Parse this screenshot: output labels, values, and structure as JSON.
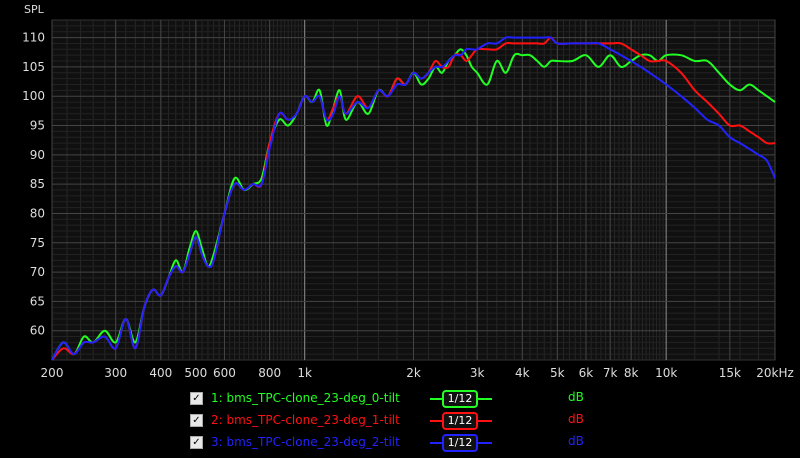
{
  "chart_data": {
    "type": "line",
    "ylabel": "SPL",
    "x_scale": "log",
    "xlim": [
      200,
      20000
    ],
    "ylim": [
      55,
      113
    ],
    "grid": true,
    "x_ticks": [
      200,
      300,
      400,
      500,
      600,
      800,
      1000,
      2000,
      3000,
      4000,
      5000,
      6000,
      7000,
      8000,
      10000,
      15000,
      20000
    ],
    "x_tick_labels": [
      "200",
      "300",
      "400",
      "500",
      "600",
      "800",
      "1k",
      "2k",
      "3k",
      "4k",
      "5k",
      "6k",
      "7k",
      "8k",
      "10k",
      "15k",
      "20kHz"
    ],
    "y_ticks": [
      60,
      65,
      70,
      75,
      80,
      85,
      90,
      95,
      100,
      105,
      110
    ],
    "y_tick_labels": [
      "60",
      "65",
      "70",
      "75",
      "80",
      "85",
      "90",
      "95",
      "100",
      "105",
      "110"
    ],
    "series": [
      {
        "name": "1: bms_TPC-clone_23-deg_0-tilt",
        "color": "#22ff22",
        "smoothing": "1/12",
        "unit": "dB",
        "x": [
          200,
          215,
          230,
          245,
          260,
          280,
          300,
          320,
          340,
          360,
          380,
          400,
          420,
          440,
          460,
          480,
          500,
          520,
          540,
          560,
          600,
          640,
          680,
          720,
          760,
          800,
          850,
          900,
          950,
          1000,
          1050,
          1100,
          1150,
          1200,
          1250,
          1300,
          1400,
          1500,
          1600,
          1700,
          1800,
          1900,
          2000,
          2100,
          2200,
          2300,
          2400,
          2500,
          2600,
          2700,
          2800,
          2900,
          3000,
          3200,
          3400,
          3600,
          3800,
          4000,
          4200,
          4400,
          4600,
          4800,
          5000,
          5500,
          6000,
          6500,
          7000,
          7500,
          8000,
          8500,
          9000,
          9500,
          10000,
          11000,
          12000,
          13000,
          14000,
          15000,
          16000,
          17000,
          18000,
          19000,
          20000
        ],
        "y": [
          55,
          58,
          56,
          59,
          58,
          60,
          58,
          62,
          58,
          64,
          67,
          66,
          69,
          72,
          70,
          74,
          77,
          74,
          71,
          73,
          80,
          86,
          84,
          85,
          86,
          92,
          96,
          95,
          97,
          100,
          99,
          101,
          95,
          98,
          101,
          96,
          99,
          97,
          101,
          100,
          103,
          102,
          104,
          102,
          103,
          105,
          104,
          106,
          107,
          108,
          107,
          105,
          104,
          102,
          106,
          104,
          107,
          107,
          107,
          106,
          105,
          106,
          106,
          106,
          107,
          105,
          107,
          105,
          106,
          107,
          107,
          106,
          107,
          107,
          106,
          106,
          104,
          102,
          101,
          102,
          101,
          100,
          99
        ]
      },
      {
        "name": "2: bms_TPC-clone_23-deg_1-tilt",
        "color": "#ff1111",
        "smoothing": "1/12",
        "unit": "dB",
        "x": [
          200,
          215,
          230,
          245,
          260,
          280,
          300,
          320,
          340,
          360,
          380,
          400,
          420,
          440,
          460,
          480,
          500,
          520,
          540,
          560,
          600,
          640,
          680,
          720,
          760,
          800,
          850,
          900,
          950,
          1000,
          1050,
          1100,
          1150,
          1200,
          1250,
          1300,
          1400,
          1500,
          1600,
          1700,
          1800,
          1900,
          2000,
          2100,
          2200,
          2300,
          2400,
          2500,
          2600,
          2700,
          2800,
          2900,
          3000,
          3200,
          3400,
          3600,
          3800,
          4000,
          4200,
          4400,
          4600,
          4800,
          5000,
          5500,
          6000,
          6500,
          7000,
          7500,
          8000,
          8500,
          9000,
          9500,
          10000,
          11000,
          12000,
          13000,
          14000,
          15000,
          16000,
          17000,
          18000,
          19000,
          20000
        ],
        "y": [
          55,
          57,
          56,
          58,
          58,
          59,
          57,
          62,
          57,
          64,
          67,
          66,
          69,
          71,
          70,
          73,
          76,
          73,
          71,
          72,
          80,
          85,
          84,
          85,
          85,
          92,
          97,
          96,
          97,
          100,
          99,
          100,
          96,
          98,
          100,
          97,
          100,
          98,
          101,
          100,
          103,
          102,
          104,
          103,
          104,
          106,
          105,
          105,
          107,
          107,
          106,
          107,
          108,
          108,
          108,
          109,
          109,
          109,
          109,
          109,
          109,
          110,
          109,
          109,
          109,
          109,
          109,
          109,
          108,
          107,
          106,
          106,
          106,
          104,
          101,
          99,
          97,
          95,
          95,
          94,
          93,
          92,
          92
        ]
      },
      {
        "name": "3: bms_TPC-clone_23-deg_2-tilt",
        "color": "#2222ff",
        "smoothing": "1/12",
        "unit": "dB",
        "x": [
          200,
          215,
          230,
          245,
          260,
          280,
          300,
          320,
          340,
          360,
          380,
          400,
          420,
          440,
          460,
          480,
          500,
          520,
          540,
          560,
          600,
          640,
          680,
          720,
          760,
          800,
          850,
          900,
          950,
          1000,
          1050,
          1100,
          1150,
          1200,
          1250,
          1300,
          1400,
          1500,
          1600,
          1700,
          1800,
          1900,
          2000,
          2100,
          2200,
          2300,
          2400,
          2500,
          2600,
          2700,
          2800,
          2900,
          3000,
          3200,
          3400,
          3600,
          3800,
          4000,
          4200,
          4400,
          4600,
          4800,
          5000,
          5500,
          6000,
          6500,
          7000,
          7500,
          8000,
          8500,
          9000,
          9500,
          10000,
          11000,
          12000,
          13000,
          14000,
          15000,
          16000,
          17000,
          18000,
          19000,
          20000
        ],
        "y": [
          55,
          58,
          56,
          58,
          58,
          59,
          57,
          62,
          57,
          64,
          67,
          66,
          69,
          71,
          70,
          73,
          76,
          73,
          71,
          72,
          80,
          85,
          84,
          85,
          85,
          91,
          97,
          96,
          97,
          100,
          99,
          100,
          96,
          97,
          100,
          97,
          99,
          98,
          101,
          100,
          102,
          102,
          104,
          103,
          104,
          105,
          105,
          106,
          107,
          107,
          108,
          108,
          108,
          109,
          109,
          110,
          110,
          110,
          110,
          110,
          110,
          110,
          109,
          109,
          109,
          109,
          108,
          107,
          106,
          105,
          104,
          103,
          102,
          100,
          98,
          96,
          95,
          93,
          92,
          91,
          90,
          89,
          86
        ]
      }
    ]
  }
}
